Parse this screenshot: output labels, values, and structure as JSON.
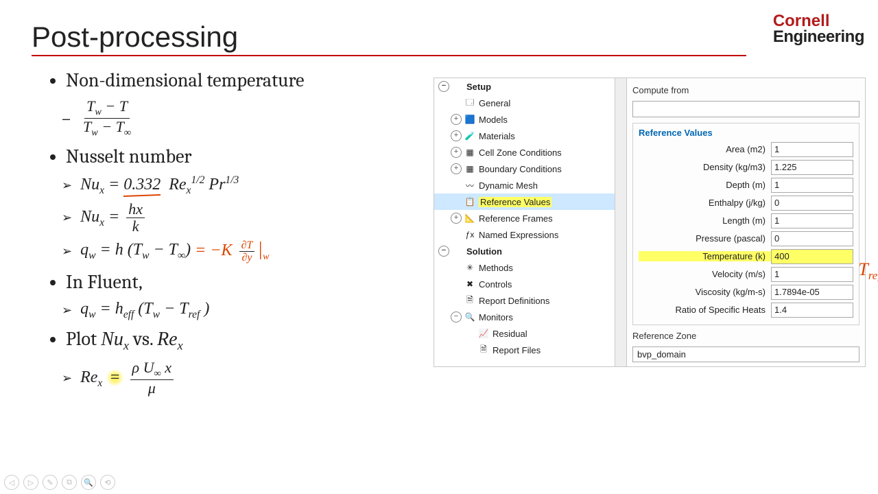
{
  "title": "Post-processing",
  "logo": {
    "top": "Cornell",
    "bottom": "Engineering"
  },
  "bullets": {
    "nondim": "Non-dimensional temperature",
    "nusselt": "Nusselt number",
    "influent": "In Fluent,",
    "plot": "Plot 𝑁𝑢ₓ vs. 𝑅𝑒ₓ"
  },
  "eq": {
    "theta_num": "T_w − T",
    "theta_den": "T_w − T_∞",
    "nu1_lhs": "Nu_x",
    "nu1_rhs_pre": "= ",
    "nu1_rhs_coef": "0.332",
    "nu1_rhs_rest": " Re_x^{1/2} Pr^{1/3}",
    "nu2": "Nu_x = hx / k",
    "qw": "q_w = h (T_w − T_∞)",
    "qw_anno": " = −K ∂T/∂y |_w",
    "qw_fluent": "q_w = h_eff (T_w − T_ref)",
    "rex": "Re_x = ρ U_∞ x / μ"
  },
  "ui": {
    "tree": [
      {
        "lvl": 0,
        "exp": "−",
        "icon": "",
        "label": "Setup",
        "bold": true
      },
      {
        "lvl": 1,
        "exp": "",
        "icon": "🗔",
        "label": "General"
      },
      {
        "lvl": 1,
        "exp": "+",
        "icon": "🟦",
        "label": "Models"
      },
      {
        "lvl": 1,
        "exp": "+",
        "icon": "🧪",
        "label": "Materials"
      },
      {
        "lvl": 1,
        "exp": "+",
        "icon": "▦",
        "label": "Cell Zone Conditions"
      },
      {
        "lvl": 1,
        "exp": "+",
        "icon": "▦",
        "label": "Boundary Conditions"
      },
      {
        "lvl": 1,
        "exp": "",
        "icon": "〰",
        "label": "Dynamic Mesh"
      },
      {
        "lvl": 1,
        "exp": "",
        "icon": "📋",
        "label": "Reference Values",
        "sel": true,
        "hl": true
      },
      {
        "lvl": 1,
        "exp": "+",
        "icon": "📐",
        "label": "Reference Frames"
      },
      {
        "lvl": 1,
        "exp": "",
        "icon": "ƒx",
        "label": "Named Expressions"
      },
      {
        "lvl": 0,
        "exp": "−",
        "icon": "",
        "label": "Solution",
        "bold": true
      },
      {
        "lvl": 1,
        "exp": "",
        "icon": "✳",
        "label": "Methods"
      },
      {
        "lvl": 1,
        "exp": "",
        "icon": "✖",
        "label": "Controls"
      },
      {
        "lvl": 1,
        "exp": "",
        "icon": "🗎",
        "label": "Report Definitions"
      },
      {
        "lvl": 1,
        "exp": "−",
        "icon": "🔍",
        "label": "Monitors"
      },
      {
        "lvl": 2,
        "exp": "",
        "icon": "📈",
        "label": "Residual"
      },
      {
        "lvl": 2,
        "exp": "",
        "icon": "🗎",
        "label": "Report Files"
      }
    ],
    "compute_from_label": "Compute from",
    "compute_from_value": "",
    "ref_values_title": "Reference Values",
    "ref_rows": [
      {
        "label": "Area (m2)",
        "value": "1"
      },
      {
        "label": "Density (kg/m3)",
        "value": "1.225"
      },
      {
        "label": "Depth (m)",
        "value": "1"
      },
      {
        "label": "Enthalpy (j/kg)",
        "value": "0"
      },
      {
        "label": "Length (m)",
        "value": "1"
      },
      {
        "label": "Pressure (pascal)",
        "value": "0"
      },
      {
        "label": "Temperature (k)",
        "value": "400",
        "hl": true
      },
      {
        "label": "Velocity (m/s)",
        "value": "1"
      },
      {
        "label": "Viscosity (kg/m-s)",
        "value": "1.7894e-05"
      },
      {
        "label": "Ratio of Specific Heats",
        "value": "1.4"
      }
    ],
    "ref_zone_label": "Reference Zone",
    "ref_zone_value": "bvp_domain",
    "tref_anno": "T_ref"
  },
  "footer": [
    "◁",
    "▷",
    "✎",
    "⧉",
    "🔍",
    "⟲"
  ]
}
